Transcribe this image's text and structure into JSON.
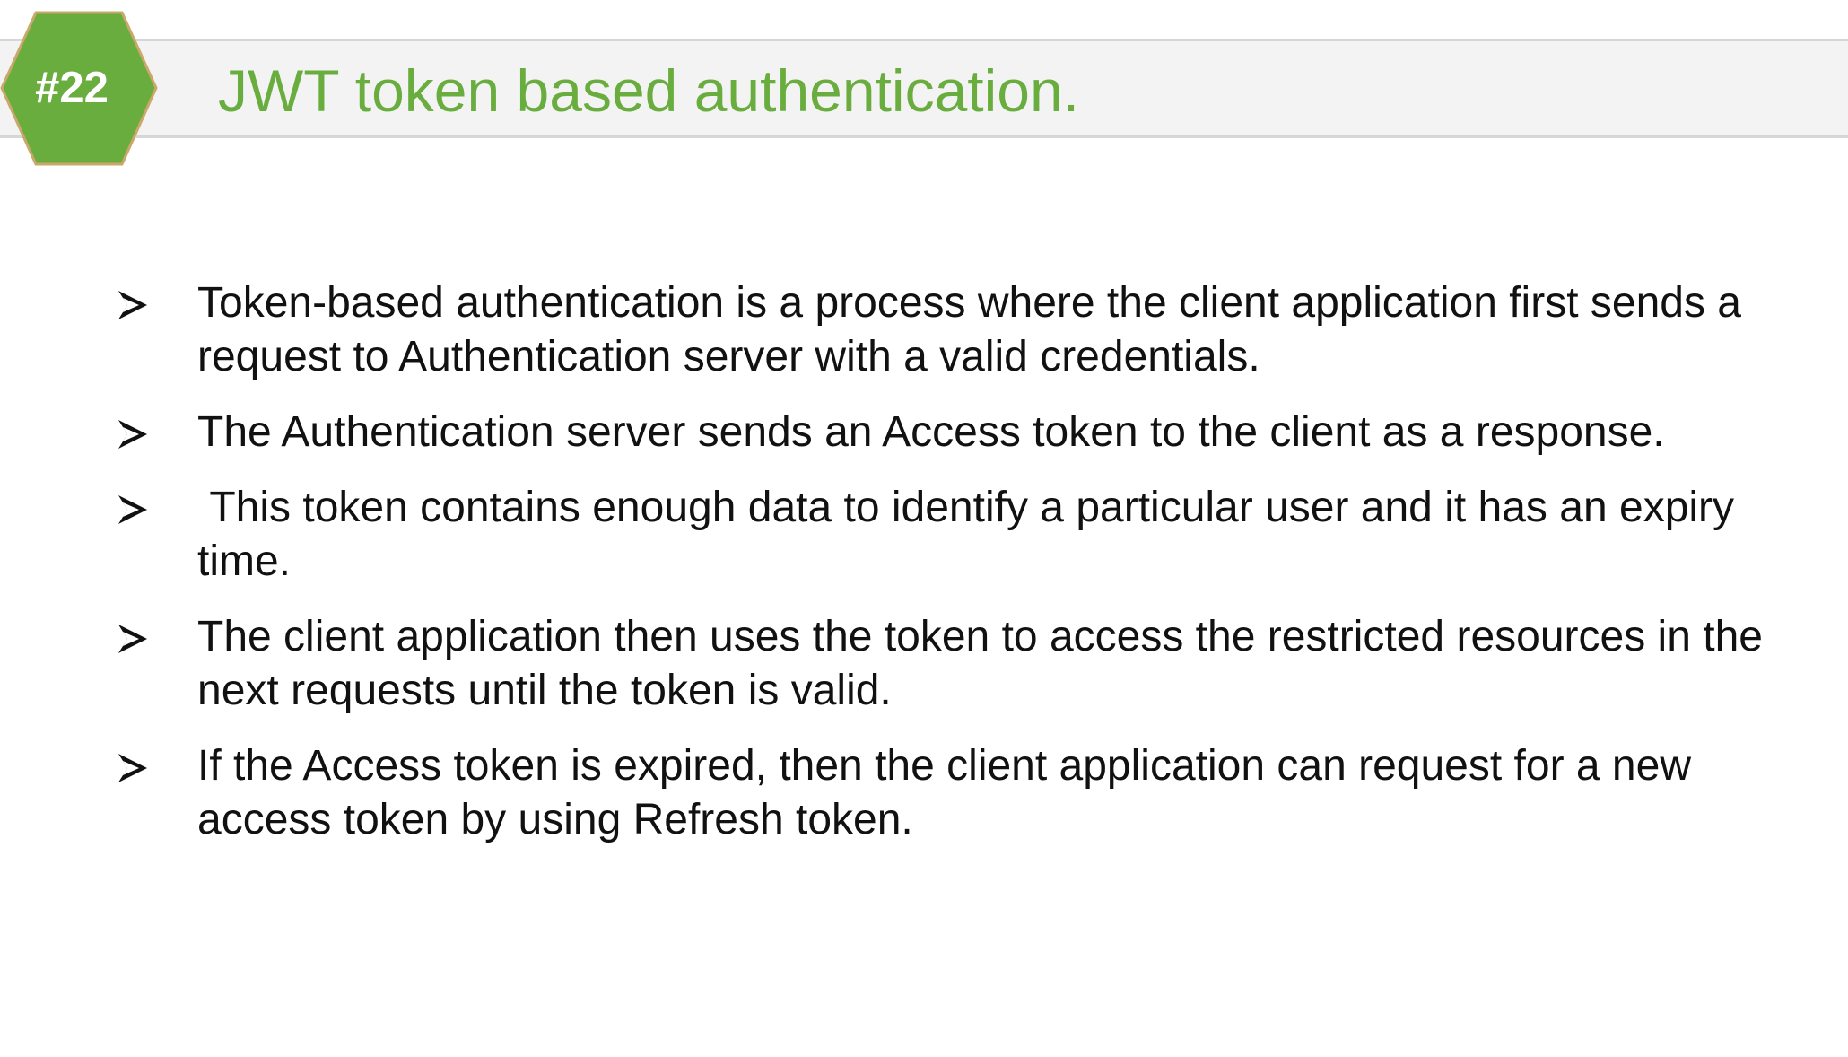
{
  "slide": {
    "badge": "#22",
    "title": "JWT token based authentication.",
    "bullets": [
      "Token-based authentication is a process where the client application first sends a request to Authentication server with a valid credentials.",
      "The Authentication server sends an Access token to the client as a response.",
      " This token contains enough data to identify a particular user and it has an expiry time.",
      "The client application then uses the token to access the restricted resources in the next requests until the token is valid.",
      "If the Access token is expired, then the client application can request for a new access token by using Refresh token."
    ],
    "bullet_icon": "arrowhead-bullet-icon",
    "colors": {
      "accent": "#6aad3f",
      "badge_fill": "#6aad3f",
      "badge_border": "#c9a86a",
      "title_band": "#f3f3f3"
    }
  }
}
